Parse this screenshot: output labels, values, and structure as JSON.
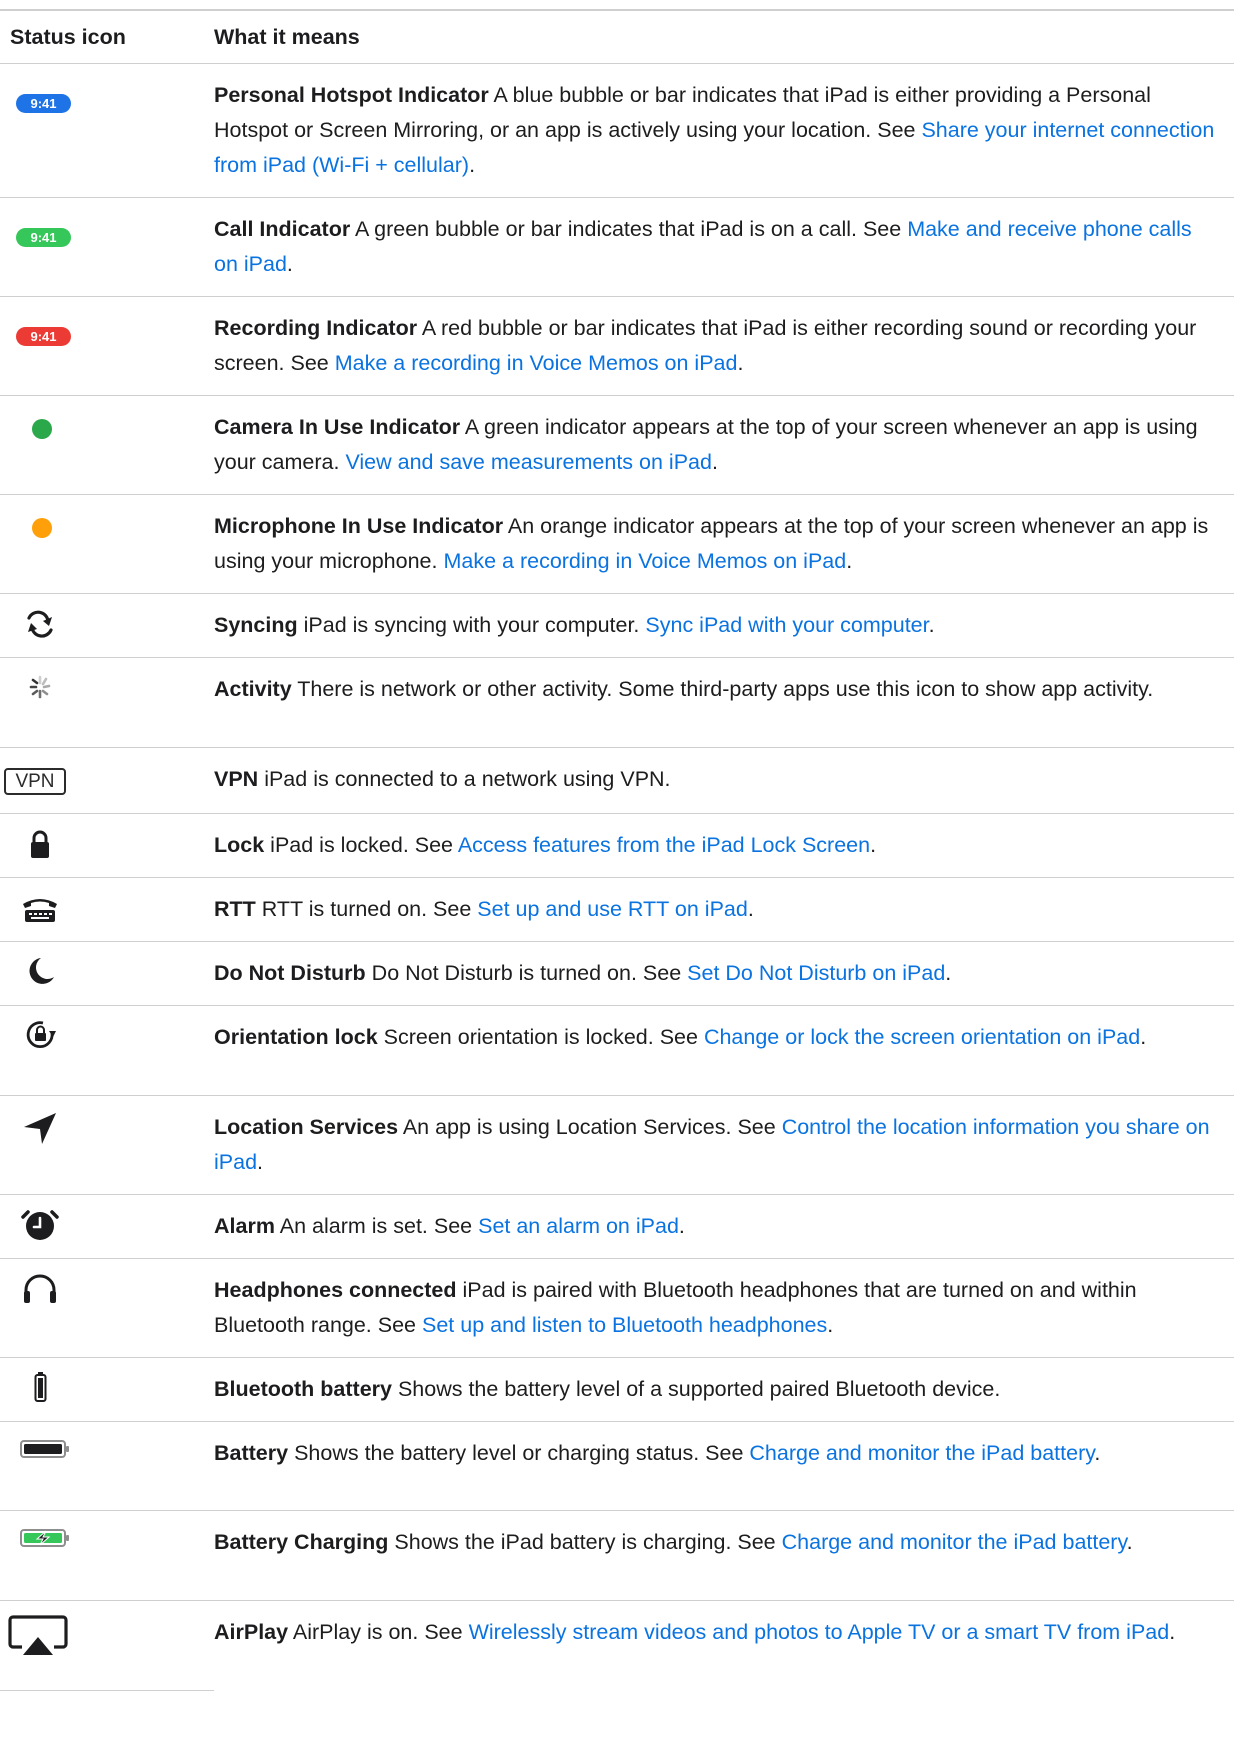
{
  "header": {
    "col1": "Status icon",
    "col2": "What it means"
  },
  "colors": {
    "link": "#0a73e0",
    "blue": "#1e73e6",
    "green": "#35c759",
    "red": "#ec3b35",
    "camera_green": "#2aa84a",
    "orange": "#ff9f0a"
  },
  "rows": [
    {
      "icon": "blue-pill-icon",
      "pill_text": "9:41",
      "term": "Personal Hotspot Indicator",
      "text": " A blue bubble or bar indicates that iPad is either providing a Personal Hotspot or Screen Mirroring, or an app is actively using your location. See ",
      "link": "Share your internet connection from iPad (Wi-Fi + cellular)",
      "after": "."
    },
    {
      "icon": "green-pill-icon",
      "pill_text": "9:41",
      "term": "Call Indicator",
      "text": " A green bubble or bar indicates that iPad is on a call. See ",
      "link": "Make and receive phone calls on iPad",
      "after": "."
    },
    {
      "icon": "red-pill-icon",
      "pill_text": "9:41",
      "term": "Recording Indicator",
      "text": " A red bubble or bar indicates that iPad is either recording sound or recording your screen. See ",
      "link": "Make a recording in Voice Memos on iPad",
      "after": "."
    },
    {
      "icon": "green-dot-icon",
      "term": "Camera In Use Indicator",
      "text": " A green indicator appears at the top of your screen whenever an app is using your camera. ",
      "link": "View and save measurements on iPad",
      "after": "."
    },
    {
      "icon": "orange-dot-icon",
      "term": "Microphone In Use Indicator",
      "text": " An orange indicator appears at the top of your screen whenever an app is using your microphone. ",
      "link": "Make a recording in Voice Memos on iPad",
      "after": "."
    },
    {
      "icon": "sync-icon",
      "term": "Syncing",
      "text": " iPad is syncing with your computer. ",
      "link": "Sync iPad with your computer",
      "after": "."
    },
    {
      "icon": "activity-icon",
      "term": "Activity",
      "text": " There is network or other activity. Some third-party apps use this icon to show app activity.",
      "link": "",
      "after": ""
    },
    {
      "icon": "vpn-icon",
      "vpn_text": "VPN",
      "term": "VPN",
      "text": " iPad is connected to a network using VPN.",
      "link": "",
      "after": ""
    },
    {
      "icon": "lock-icon",
      "term": "Lock",
      "text": " iPad is locked. See ",
      "link": "Access features from the iPad Lock Screen",
      "after": "."
    },
    {
      "icon": "rtt-icon",
      "term": "RTT",
      "text": " RTT is turned on. See ",
      "link": "Set up and use RTT on iPad",
      "after": "."
    },
    {
      "icon": "moon-icon",
      "term": "Do Not Disturb",
      "text": " Do Not Disturb is turned on. See ",
      "link": "Set Do Not Disturb on iPad",
      "after": "."
    },
    {
      "icon": "orientation-lock-icon",
      "term": "Orientation lock",
      "text": " Screen orientation is locked. See ",
      "link": "Change or lock the screen orientation on iPad",
      "after": "."
    },
    {
      "icon": "location-arrow-icon",
      "term": "Location Services",
      "text": " An app is using Location Services. See ",
      "link": "Control the location information you share on iPad",
      "after": "."
    },
    {
      "icon": "alarm-icon",
      "term": "Alarm",
      "text": " An alarm is set. See ",
      "link": "Set an alarm on iPad",
      "after": "."
    },
    {
      "icon": "headphones-icon",
      "term": "Headphones connected",
      "text": " iPad is paired with Bluetooth headphones that are turned on and within Bluetooth range. See ",
      "link": "Set up and listen to Bluetooth headphones",
      "after": "."
    },
    {
      "icon": "bluetooth-battery-icon",
      "term": "Bluetooth battery",
      "text": " Shows the battery level of a supported paired Bluetooth device.",
      "link": "",
      "after": ""
    },
    {
      "icon": "battery-icon",
      "term": "Battery",
      "text": " Shows the battery level or charging status. See ",
      "link": "Charge and monitor the iPad battery",
      "after": "."
    },
    {
      "icon": "battery-charging-icon",
      "term": "Battery Charging",
      "text": " Shows the iPad battery is charging. See ",
      "link": "Charge and monitor the iPad battery",
      "after": "."
    },
    {
      "icon": "airplay-icon",
      "term": "AirPlay",
      "text": " AirPlay is on. See ",
      "link": "Wirelessly stream videos and photos to Apple TV or a smart TV from iPad",
      "after": "."
    }
  ]
}
